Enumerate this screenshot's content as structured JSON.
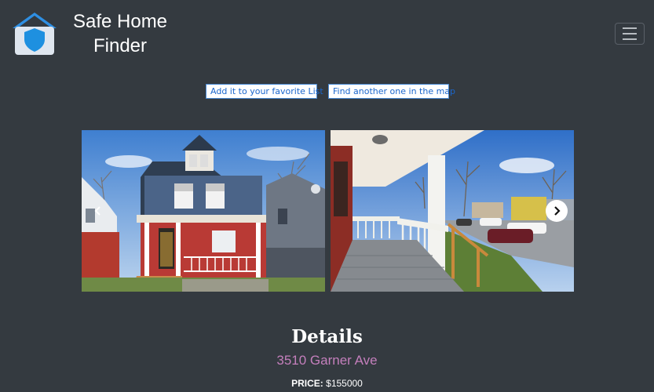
{
  "brand": {
    "line1": "Safe Home",
    "line2": "Finder"
  },
  "icons": {
    "logo": "house-shield-icon",
    "menu": "hamburger-icon",
    "prev": "chevron-left-icon",
    "next": "chevron-right-icon"
  },
  "actions": {
    "favorite_label": "Add it to your favorite List",
    "map_label": "Find another one in the map"
  },
  "carousel": {
    "slides": [
      {
        "subject": "house-front-photo"
      },
      {
        "subject": "porch-view-photo"
      }
    ]
  },
  "details": {
    "title": "Details",
    "address": "3510 Garner Ave",
    "price_label": "PRICE:",
    "price_value": "$155000"
  },
  "colors": {
    "background": "#343a40",
    "address": "#c47fbc",
    "button_text": "#1a66cc",
    "logo_shield": "#1e90e0"
  }
}
